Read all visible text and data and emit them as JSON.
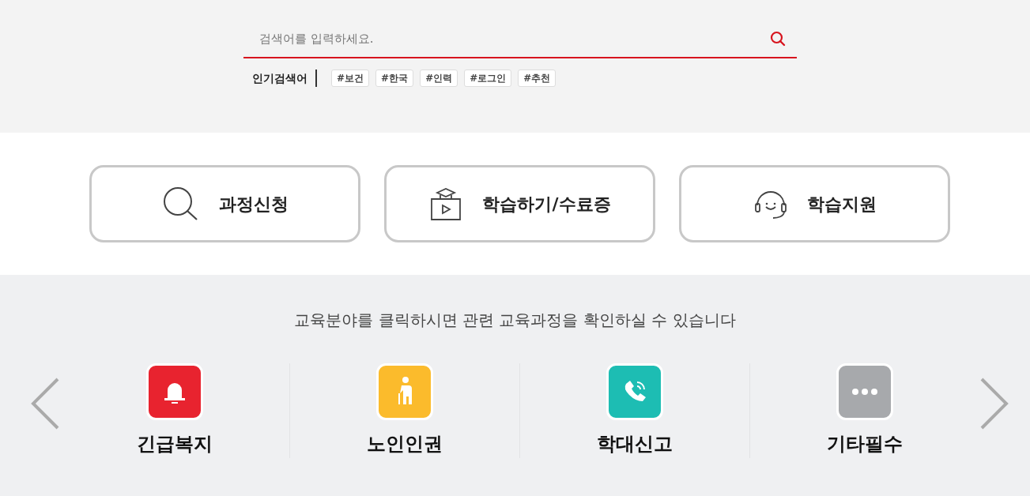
{
  "search": {
    "placeholder": "검색어를 입력하세요."
  },
  "popular": {
    "label": "인기검색어",
    "tags": [
      "#보건",
      "#한국",
      "#인력",
      "#로그인",
      "#추천"
    ]
  },
  "quick_links": [
    {
      "kind": "search",
      "label": "과정신청"
    },
    {
      "kind": "study",
      "label": "학습하기/수료증"
    },
    {
      "kind": "support",
      "label": "학습지원"
    }
  ],
  "fields": {
    "intro": "교육분야를 클릭하시면 관련 교육과정을 확인하실 수 있습니다",
    "items": [
      {
        "kind": "alarm",
        "label": "긴급복지",
        "color": "#e8232f"
      },
      {
        "kind": "elder",
        "label": "노인인권",
        "color": "#fbbb2c"
      },
      {
        "kind": "phone",
        "label": "학대신고",
        "color": "#1dbdb3"
      },
      {
        "kind": "more",
        "label": "기타필수",
        "color": "#a7a9ac"
      }
    ]
  }
}
